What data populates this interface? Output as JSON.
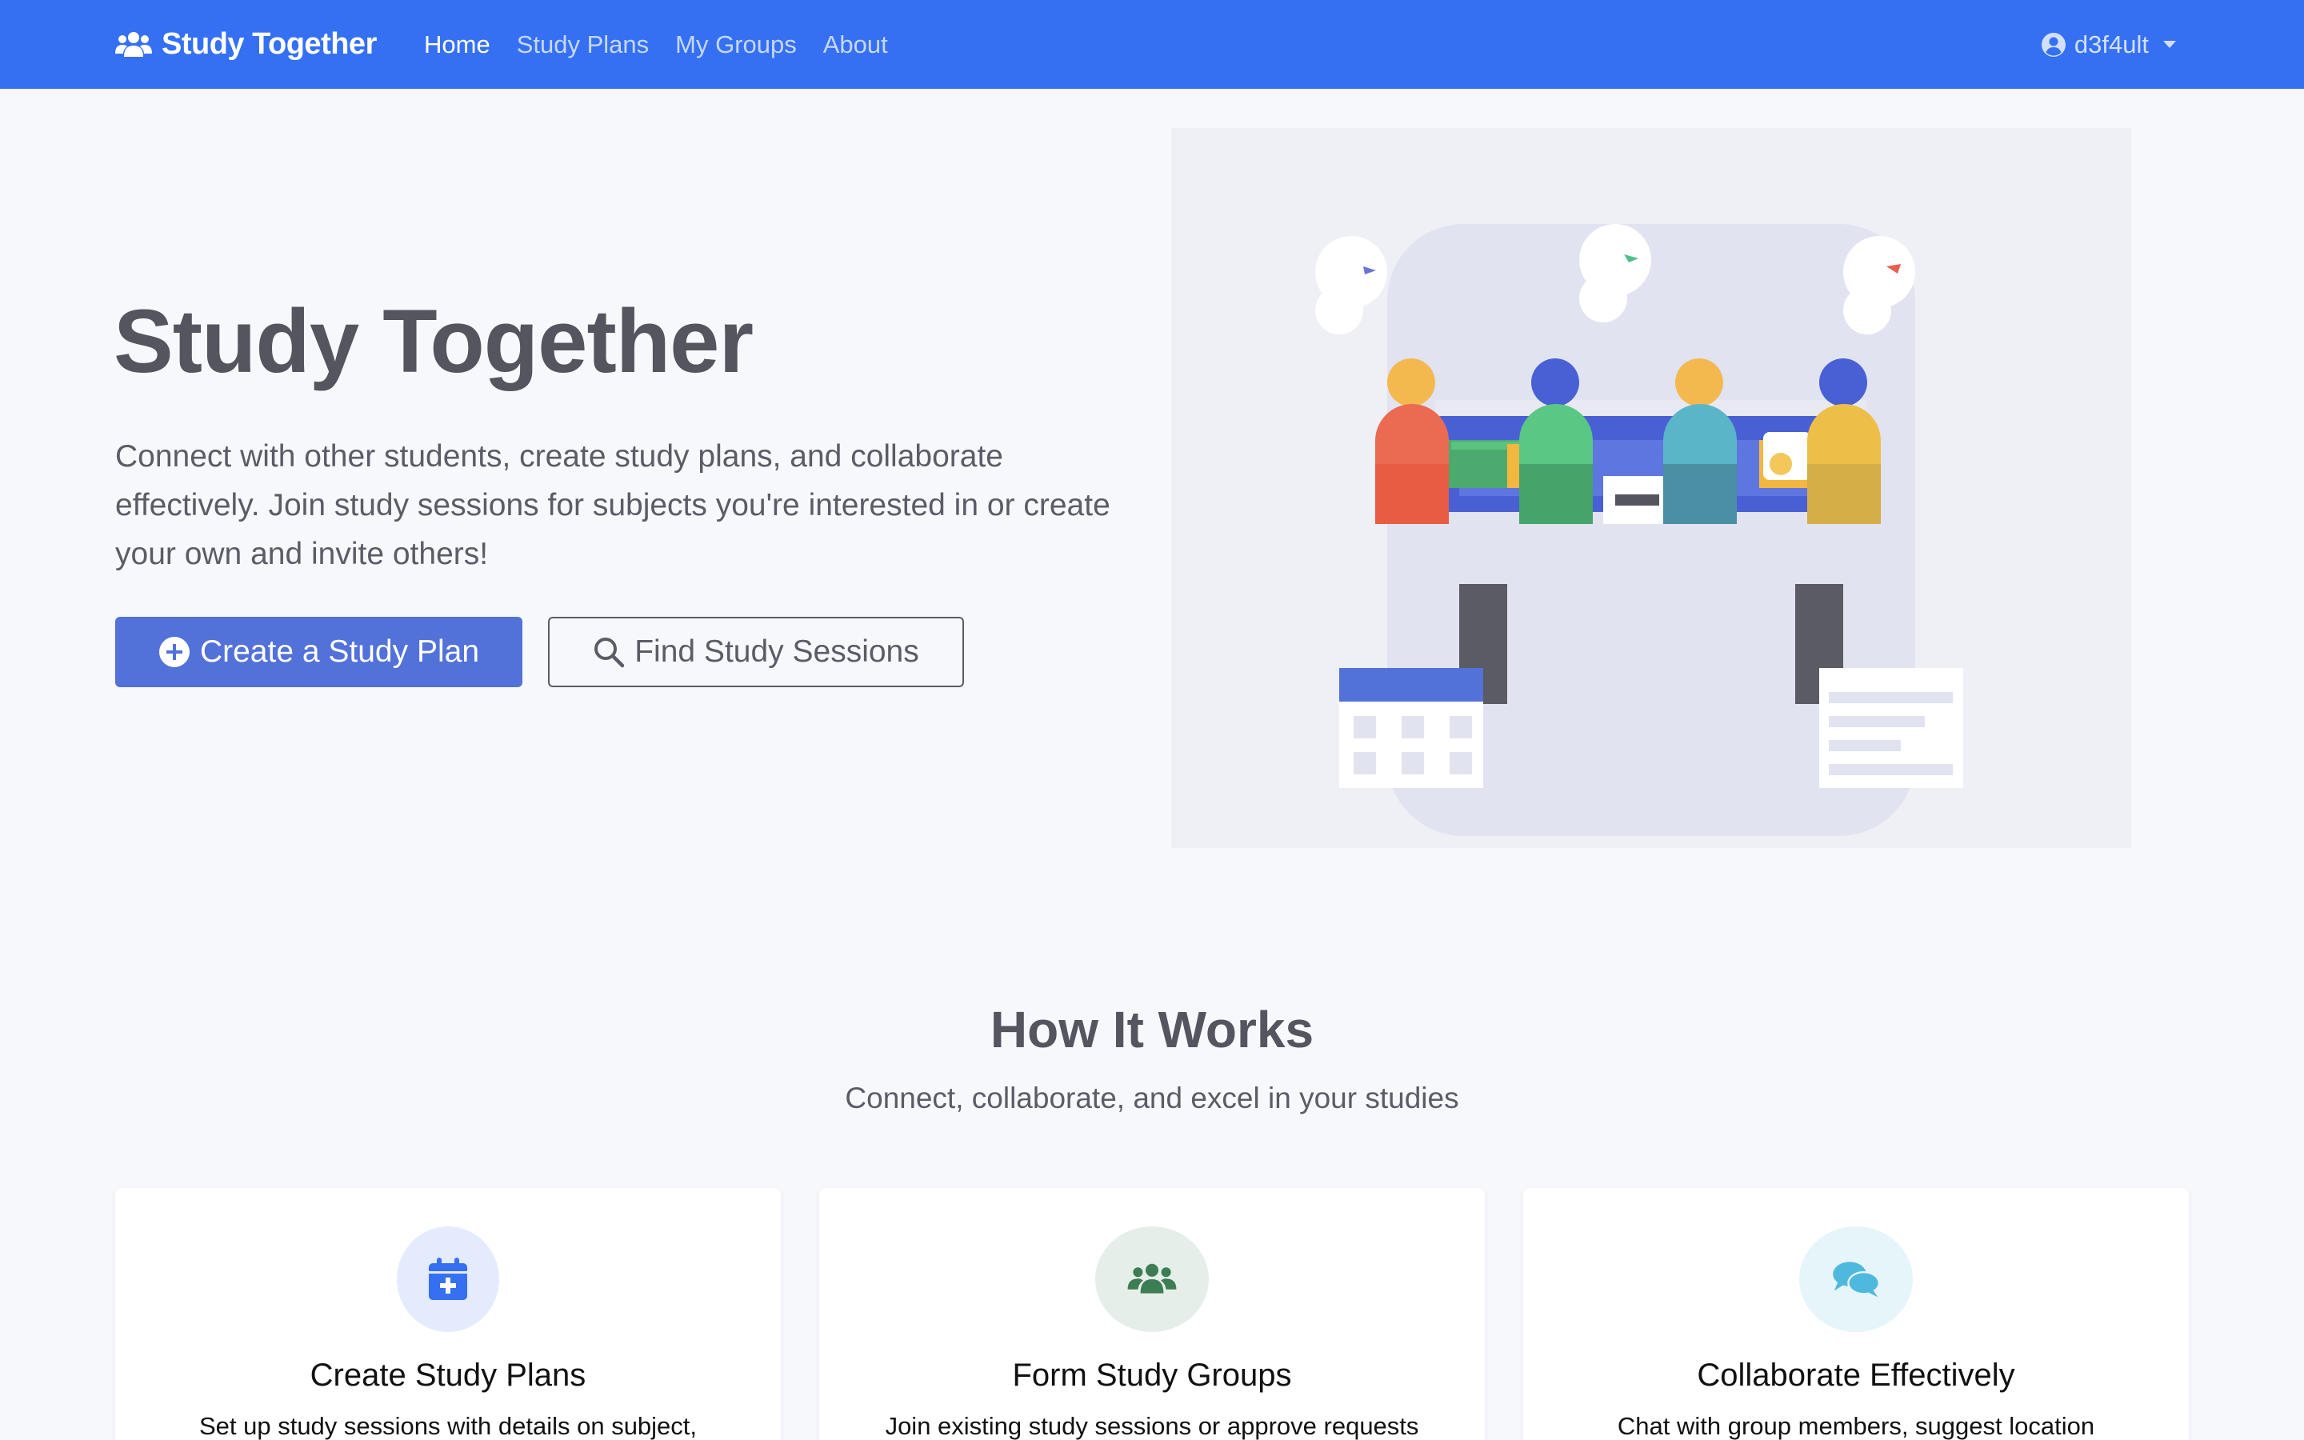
{
  "navbar": {
    "brand": "Study Together",
    "links": [
      {
        "label": "Home",
        "active": true
      },
      {
        "label": "Study Plans",
        "active": false
      },
      {
        "label": "My Groups",
        "active": false
      },
      {
        "label": "About",
        "active": false
      }
    ],
    "user": "d3f4ult"
  },
  "hero": {
    "title": "Study Together",
    "lead": "Connect with other students, create study plans, and collaborate effectively. Join study sessions for subjects you're interested in or create your own and invite others!",
    "primary_button": "Create a Study Plan",
    "secondary_button": "Find Study Sessions"
  },
  "how_it_works": {
    "title": "How It Works",
    "subtitle": "Connect, collaborate, and excel in your studies",
    "cards": [
      {
        "icon": "calendar-plus-icon",
        "title": "Create Study Plans",
        "text": "Set up study sessions with details on subject,"
      },
      {
        "icon": "users-icon",
        "title": "Form Study Groups",
        "text": "Join existing study sessions or approve requests"
      },
      {
        "icon": "comments-icon",
        "title": "Collaborate Effectively",
        "text": "Chat with group members, suggest location"
      }
    ]
  },
  "colors": {
    "navbar": "#3570f3",
    "primary_button": "#5271d9",
    "page_background": "#f7f8fc"
  }
}
